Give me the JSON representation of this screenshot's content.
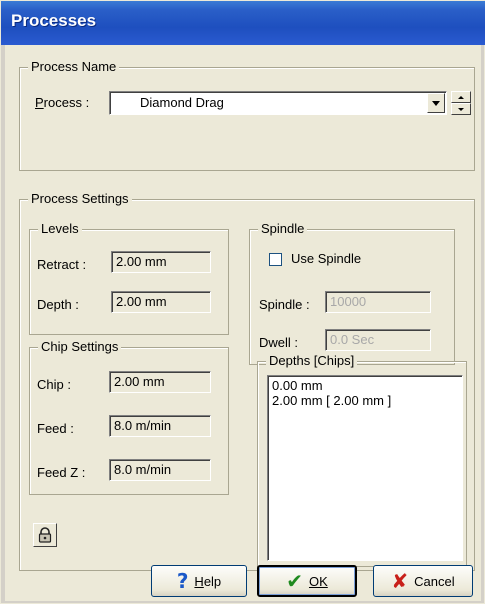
{
  "window": {
    "title": "Processes"
  },
  "process_name": {
    "legend": "Process Name",
    "label": "Process :",
    "value": "Diamond Drag"
  },
  "process_settings": {
    "legend": "Process Settings",
    "levels": {
      "legend": "Levels",
      "retract_label": "Retract :",
      "retract_value": "2.00 mm",
      "depth_label": "Depth :",
      "depth_value": "2.00 mm"
    },
    "chip_settings": {
      "legend": "Chip Settings",
      "chip_label": "Chip :",
      "chip_value": "2.00 mm",
      "feed_label": "Feed :",
      "feed_value": "8.0 m/min",
      "feedz_label": "Feed Z :",
      "feedz_value": "8.0 m/min"
    },
    "spindle": {
      "legend": "Spindle",
      "use_spindle_label": "Use Spindle",
      "use_spindle_checked": false,
      "spindle_label": "Spindle :",
      "spindle_value": "10000",
      "dwell_label": "Dwell :",
      "dwell_value": "0.0 Sec"
    },
    "depths": {
      "legend": "Depths [Chips]",
      "items": [
        "0.00 mm",
        "2.00 mm  [ 2.00 mm ]"
      ]
    }
  },
  "buttons": {
    "help": "Help",
    "ok": "OK",
    "cancel": "Cancel"
  },
  "icons": {
    "help": "question-icon",
    "ok": "checkmark-icon",
    "cancel": "x-icon",
    "lock": "lock-icon"
  }
}
